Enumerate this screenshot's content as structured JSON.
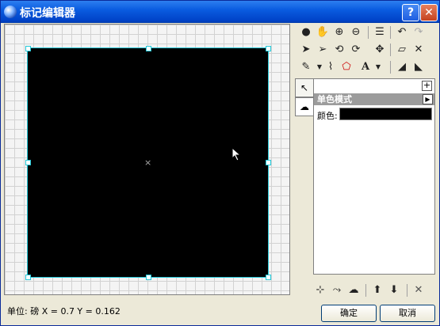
{
  "window": {
    "title": "标记编辑器",
    "help_label": "?",
    "close_label": "✕"
  },
  "toolbar": {
    "row1": [
      "globe-icon",
      "hand-icon",
      "zoom-in-icon",
      "zoom-out-icon",
      "layers-icon",
      "undo-icon",
      "redo-icon"
    ],
    "row2": [
      "select-icon",
      "node-select-icon",
      "rotate-left-icon",
      "rotate-right-icon",
      "move-icon",
      "eraser-icon",
      "delete-icon"
    ],
    "row3": [
      "pen-icon",
      "lasso-icon",
      "shape-icon",
      "text-icon",
      "ruler-icon",
      "measure-icon"
    ]
  },
  "properties": {
    "section_title": "单色模式",
    "color_label": "颜色:",
    "color_value": "#000000",
    "add_label": "+"
  },
  "status": {
    "text": "单位: 磅   X = 0.7   Y = 0.162"
  },
  "buttons": {
    "ok": "确定",
    "cancel": "取消"
  },
  "bottom_tools": [
    "add-point-icon",
    "edit-point-icon",
    "shape-tool-icon",
    "move-up-icon",
    "move-down-icon",
    "remove-icon"
  ]
}
